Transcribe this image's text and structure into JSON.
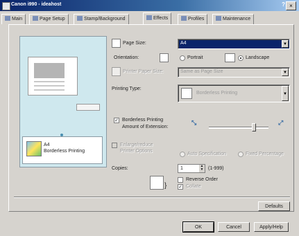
{
  "window": {
    "title": "Canon i990 - ideahost",
    "help": "?",
    "close": "×"
  },
  "tabs": [
    {
      "label": "Main",
      "selected": false
    },
    {
      "label": "Page Setup",
      "selected": false
    },
    {
      "label": "Stamp/Background",
      "selected": false
    },
    {
      "label": "Effects",
      "selected": true
    },
    {
      "label": "Profiles",
      "selected": false
    },
    {
      "label": "Maintenance",
      "selected": false
    }
  ],
  "preview": {
    "quality_line1": "A4",
    "quality_line2": "Borderless Printing"
  },
  "page_size": {
    "label": "Page Size:",
    "value": "A4"
  },
  "orientation": {
    "label": "Orientation:",
    "portrait": "Portrait",
    "landscape": "Landscape",
    "selected": "landscape"
  },
  "printer_paper_size": {
    "label": "Printer Paper Size:",
    "value": "Same as Page Size"
  },
  "printing_type": {
    "label": "Printing Type:",
    "value": "Borderless Printing"
  },
  "borderless": {
    "checkbox_label": "Borderless Printing",
    "extension_label": "Amount of Extension:",
    "slider_value": 0.75
  },
  "scaled": {
    "checkbox_label": "Enlarge/reduce",
    "sub_label": "Printer Options",
    "option1": "Auto Specification",
    "option2": "Fixed Percentage"
  },
  "copies": {
    "label": "Copies:",
    "value": "1",
    "range": "(1-999)",
    "reverse": "Reverse Order",
    "collate": "Collate"
  },
  "buttons": {
    "defaults": "Defaults",
    "ok": "OK",
    "cancel": "Cancel",
    "apply": "Apply/Help"
  }
}
